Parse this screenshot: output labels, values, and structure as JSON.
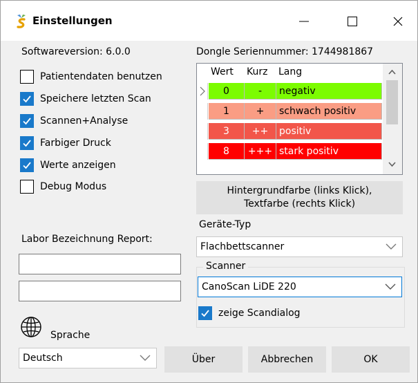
{
  "window": {
    "title": "Einstellungen"
  },
  "info": {
    "software_version": "Softwareversion: 6.0.0",
    "dongle_serial": "Dongle Seriennummer: 1744981867"
  },
  "options": [
    {
      "label": "Patientendaten benutzen",
      "checked": false
    },
    {
      "label": "Speichere letzten Scan",
      "checked": true
    },
    {
      "label": "Scannen+Analyse",
      "checked": true
    },
    {
      "label": "Farbiger Druck",
      "checked": true
    },
    {
      "label": "Werte anzeigen",
      "checked": true
    },
    {
      "label": "Debug Modus",
      "checked": false
    }
  ],
  "grid": {
    "headers": [
      "Wert",
      "Kurz",
      "Lang"
    ],
    "rows": [
      {
        "wert": "0",
        "kurz": "-",
        "lang": "negativ",
        "bg": "#7cfc00",
        "fg": "#000000"
      },
      {
        "wert": "1",
        "kurz": "+",
        "lang": "schwach positiv",
        "bg": "#fa9d84",
        "fg": "#000000"
      },
      {
        "wert": "3",
        "kurz": "++",
        "lang": "positiv",
        "bg": "#f2564a",
        "fg": "#ffffff"
      },
      {
        "wert": "8",
        "kurz": "+++",
        "lang": "stark positiv",
        "bg": "#ff0000",
        "fg": "#ffffff"
      }
    ]
  },
  "color_button": {
    "line1": "Hintergrundfarbe (links Klick),",
    "line2": "Textfarbe (rechts Klick)"
  },
  "device_type": {
    "label": "Geräte-Typ",
    "value": "Flachbettscanner"
  },
  "lab_report": {
    "label": "Labor Bezeichnung Report:",
    "line1": "",
    "line2": ""
  },
  "scanner_group": {
    "label": "Scanner",
    "value": "CanoScan LiDE 220",
    "show_dialog_label": "zeige Scandialog",
    "show_dialog_checked": true
  },
  "language": {
    "label": "Sprache",
    "value": "Deutsch"
  },
  "buttons": {
    "about": "Über",
    "cancel": "Abbrechen",
    "ok": "OK"
  },
  "colors": {
    "accent": "#1979ca",
    "focus": "#0078d7"
  }
}
